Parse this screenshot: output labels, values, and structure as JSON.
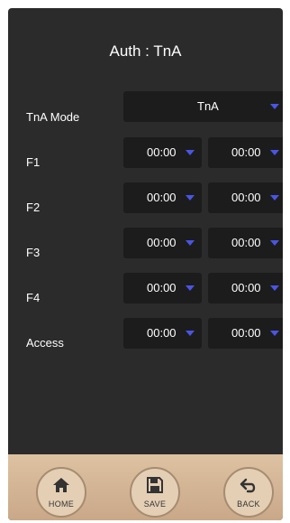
{
  "title": "Auth : TnA",
  "tna_mode": {
    "label": "TnA Mode",
    "value": "TnA"
  },
  "rows": [
    {
      "label": "F1",
      "from": "00:00",
      "to": "00:00"
    },
    {
      "label": "F2",
      "from": "00:00",
      "to": "00:00"
    },
    {
      "label": "F3",
      "from": "00:00",
      "to": "00:00"
    },
    {
      "label": "F4",
      "from": "00:00",
      "to": "00:00"
    },
    {
      "label": "Access",
      "from": "00:00",
      "to": "00:00"
    }
  ],
  "footer": {
    "home_label": "HOME",
    "save_label": "SAVE",
    "back_label": "BACK"
  },
  "colors": {
    "background": "#2b2b2b",
    "dropdown_bg": "#1c1c1c",
    "caret": "#4a55e6",
    "footer": "#d4b896"
  },
  "icons": {
    "home": "home-icon",
    "save": "floppy-disk-icon",
    "back": "undo-arrow-icon",
    "caret": "caret-down-icon"
  }
}
